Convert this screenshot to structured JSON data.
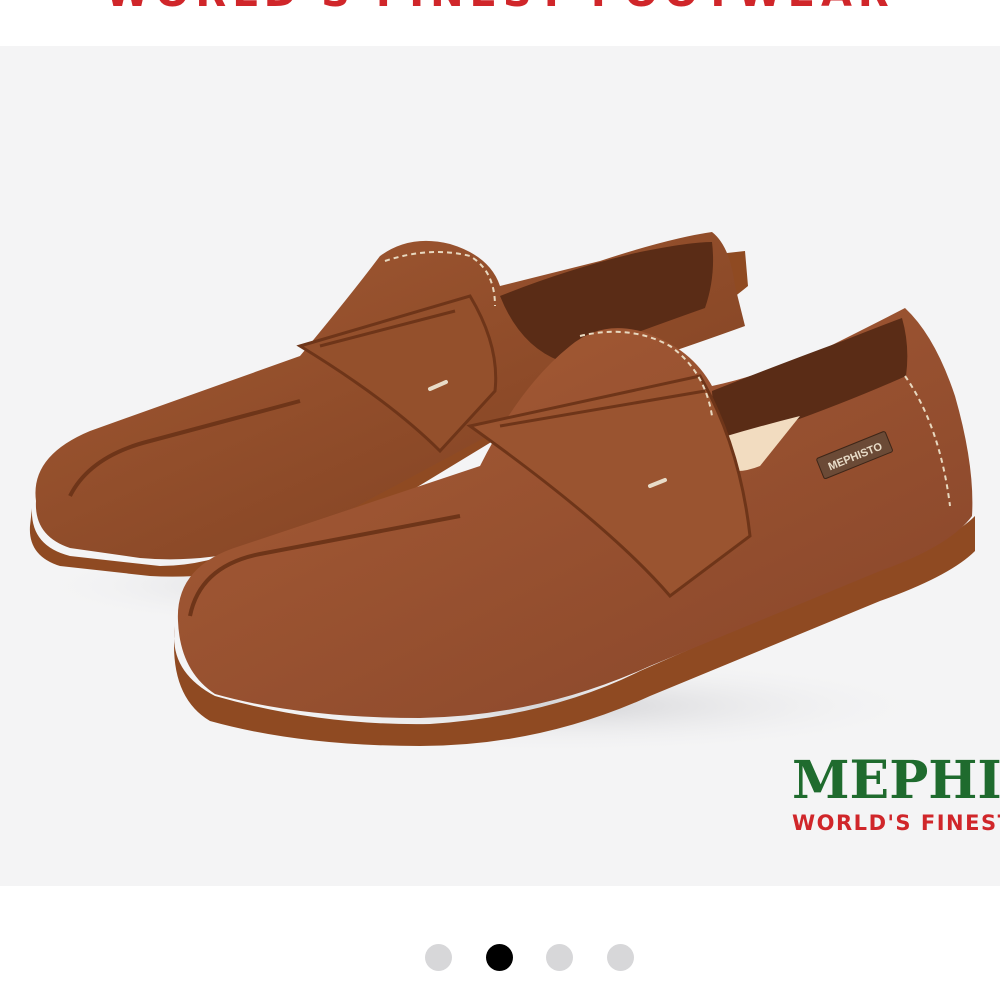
{
  "header": {
    "tagline": "WORLD'S FINEST FOOTWEAR",
    "tagline_color": "#d0262a"
  },
  "product_image": {
    "subject": "brown suede penny loafers",
    "label_text": "MEPHISTO",
    "colors": {
      "background": "#f4f4f5",
      "suede": "#9a5230",
      "sole": "#8f4a22"
    }
  },
  "brand": {
    "name": "MEPHISTO",
    "tagline": "WORLD'S FINEST FOOTWEAR",
    "name_color": "#1f6b2e",
    "tagline_color": "#d0262a"
  },
  "carousel": {
    "slide_count": 4,
    "active_index": 1,
    "active_color": "#000000",
    "inactive_color": "#d7d7d9"
  }
}
